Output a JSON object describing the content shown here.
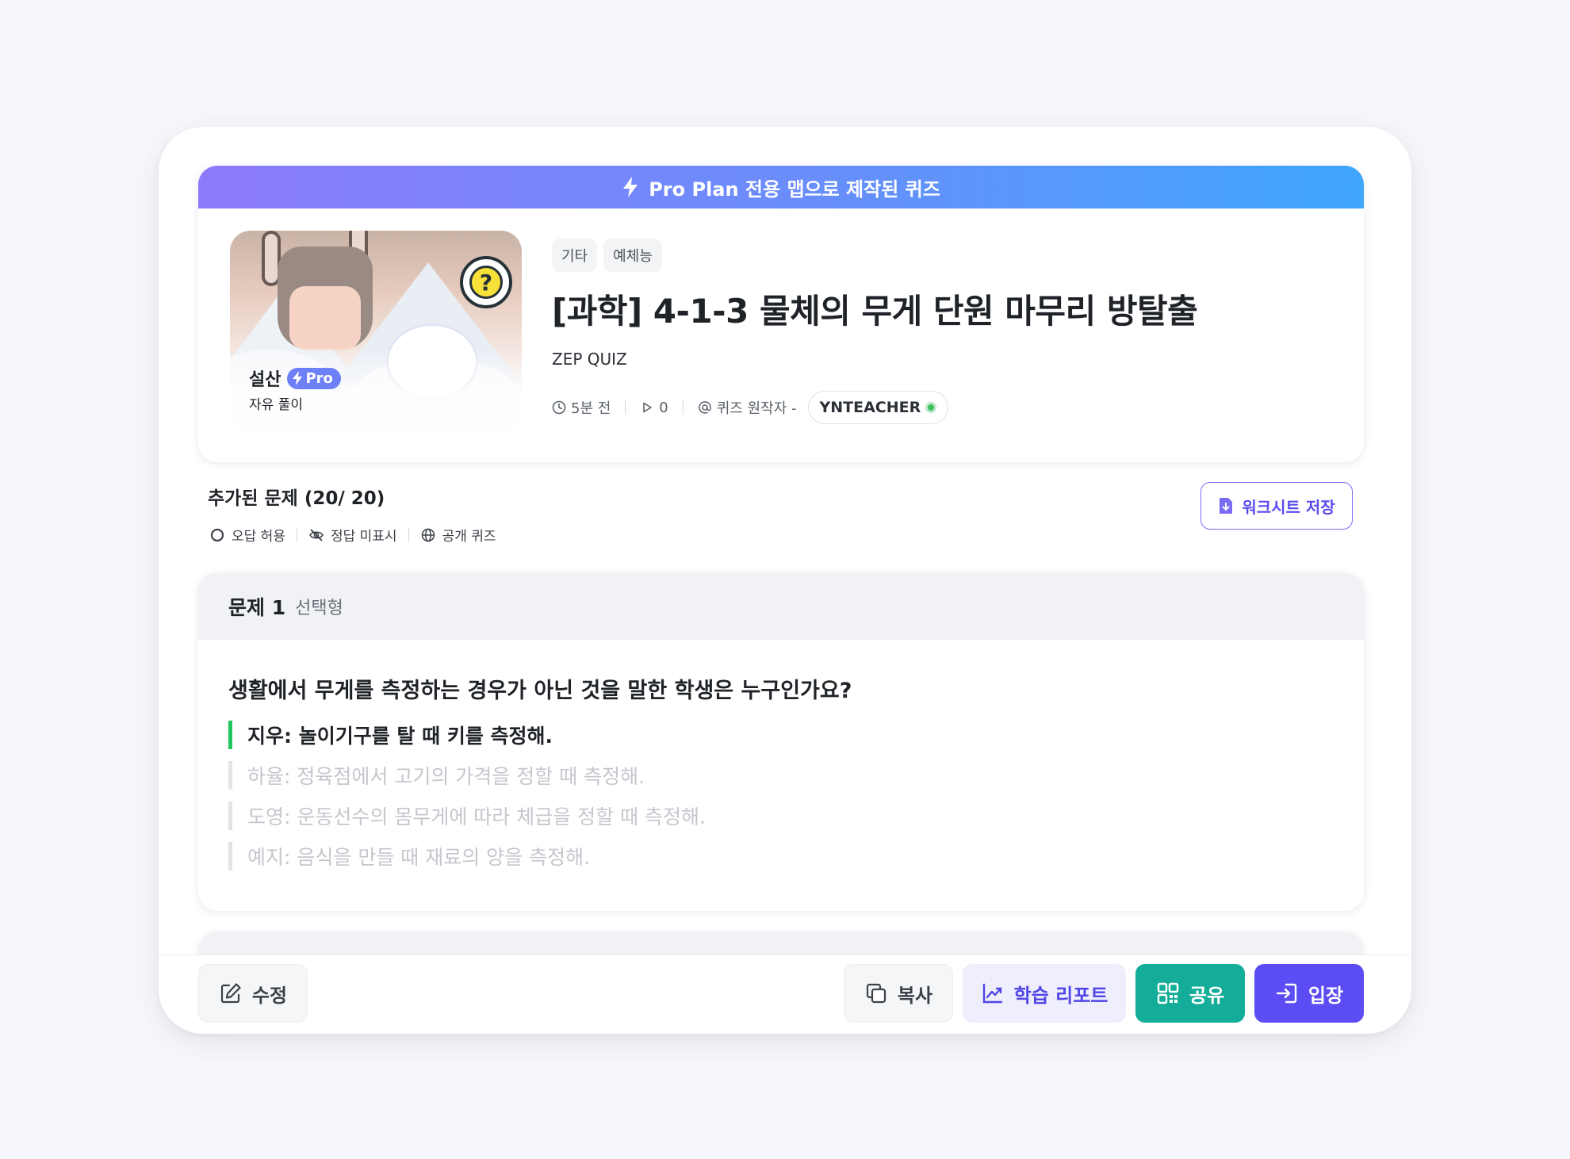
{
  "banner": {
    "text": "Pro Plan 전용 맵으로 제작된 퀴즈"
  },
  "map": {
    "name": "설산",
    "badge": "Pro",
    "mode": "자유 풀이"
  },
  "tags": [
    "기타",
    "예체능"
  ],
  "quiz": {
    "title": "[과학] 4-1-3 물체의 무게 단원 마무리 방탈출",
    "author": "ZEP QUIZ",
    "time_ago": "5분 전",
    "plays": "0",
    "original_author_label": "퀴즈 원작자 -",
    "creator": "YNTEACHER"
  },
  "summary": {
    "title": "추가된 문제 (20/ 20)",
    "options": [
      "오답 허용",
      "정답 미표시",
      "공개 퀴즈"
    ],
    "worksheet_button": "워크시트 저장"
  },
  "question": {
    "number": "문제 1",
    "type": "선택형",
    "text": "생활에서 무게를 측정하는 경우가 아닌 것을 말한 학생은 누구인가요?",
    "choices": [
      "지우: 놀이기구를 탈 때 키를 측정해.",
      "하율: 정육점에서 고기의 가격을 정할 때 측정해.",
      "도영: 운동선수의 몸무게에 따라 체급을 정할 때 측정해.",
      "예지: 음식을 만들 때 재료의 양을 측정해."
    ]
  },
  "actions": {
    "edit": "수정",
    "copy": "복사",
    "report": "학습 리포트",
    "share": "공유",
    "enter": "입장"
  },
  "colors": {
    "primary": "#5b4cf3",
    "share": "#13ad9a",
    "correct": "#22c55e",
    "banner_start": "#8d7bfb",
    "banner_end": "#3fa6fb"
  }
}
